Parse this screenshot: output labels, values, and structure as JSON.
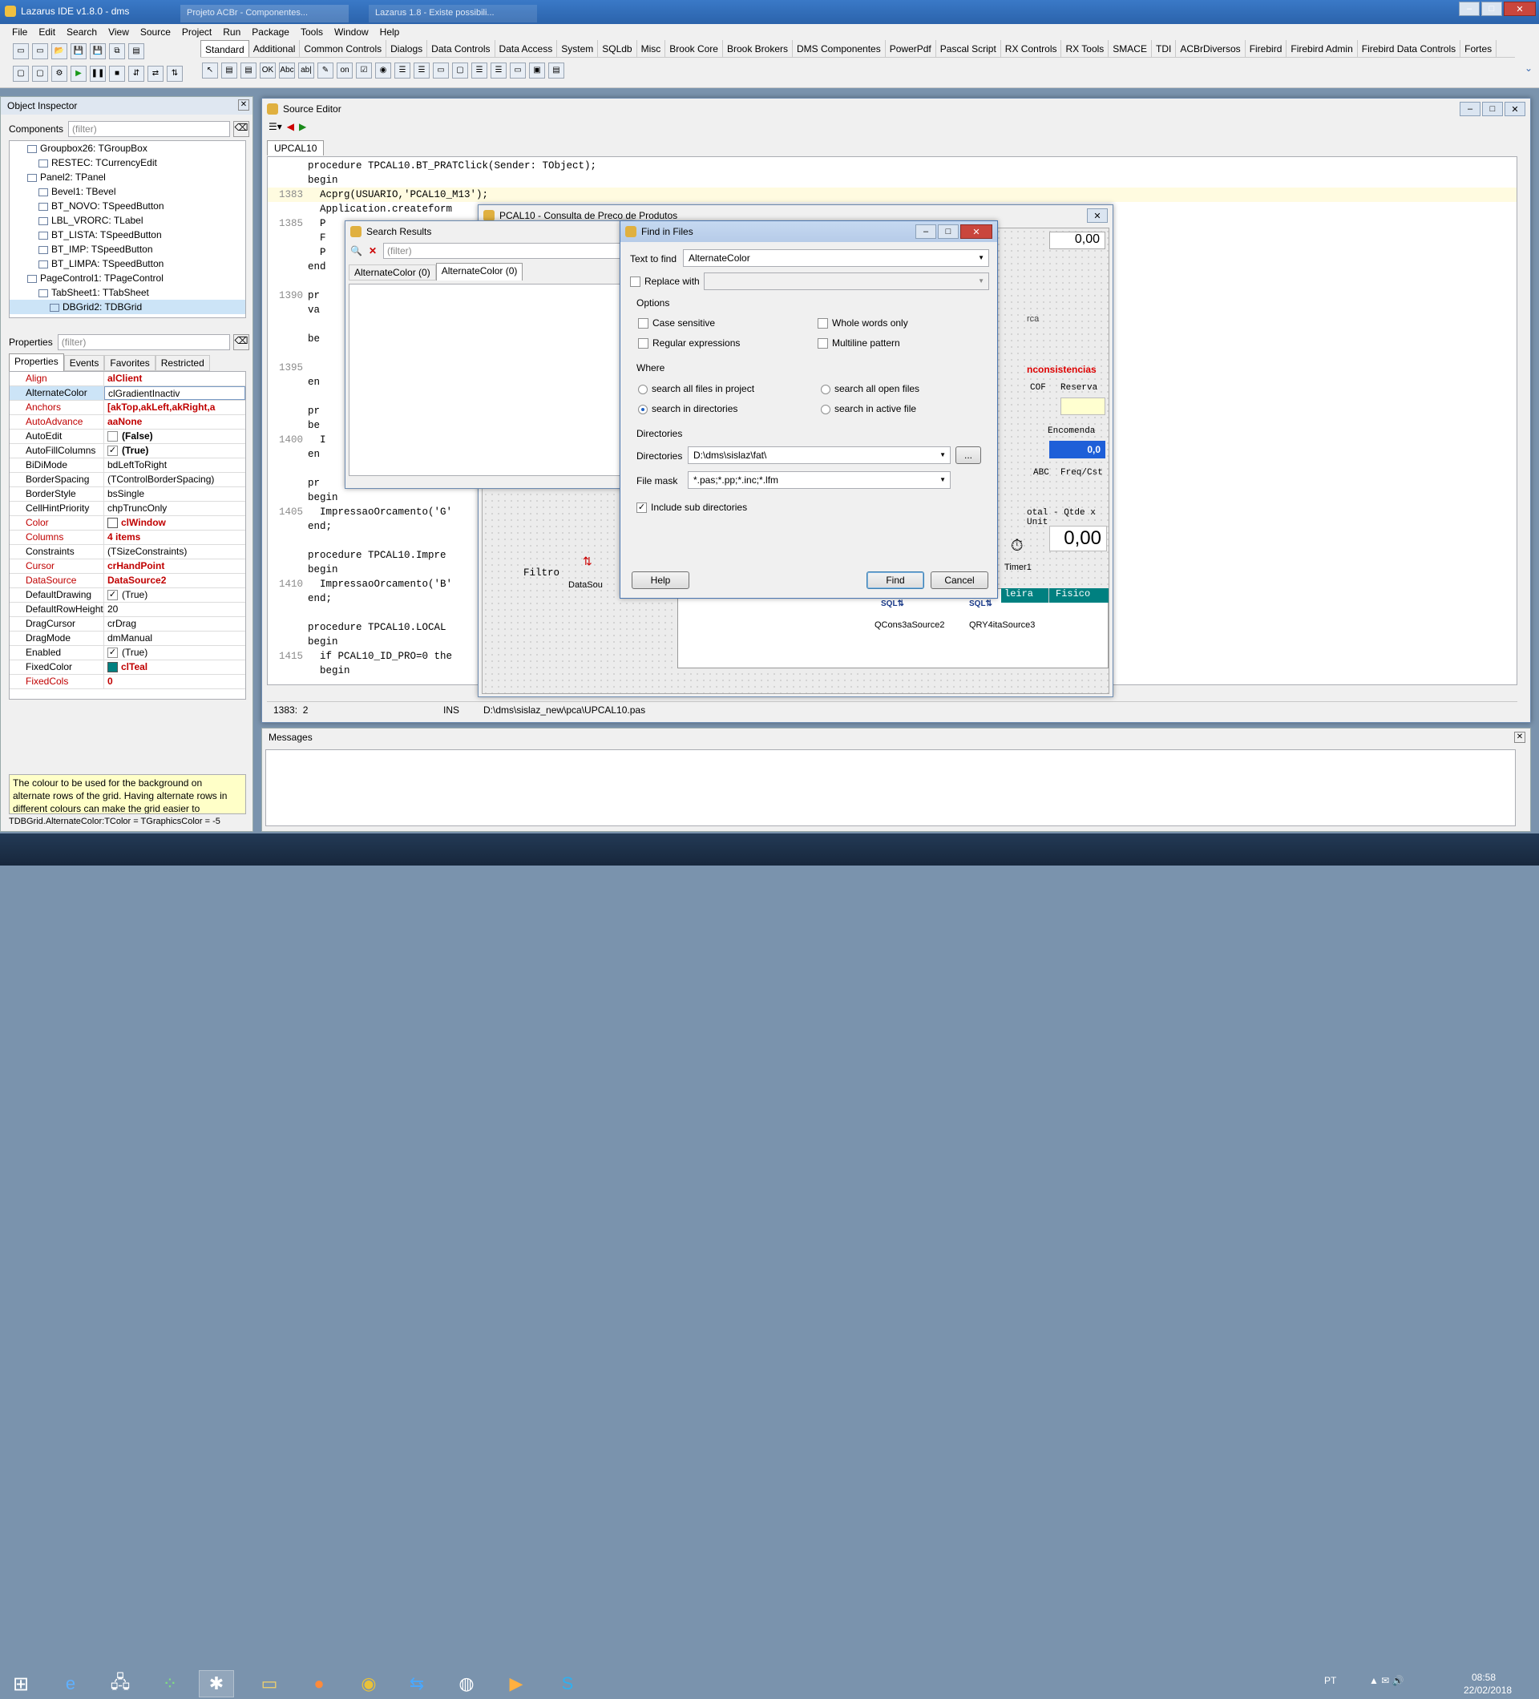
{
  "ide": {
    "title": "Lazarus IDE v1.8.0 - dms",
    "browser_tabs": [
      "Projeto ACBr - Componentes...",
      "Lazarus 1.8 - Existe possibili..."
    ],
    "menu": [
      "File",
      "Edit",
      "Search",
      "View",
      "Source",
      "Project",
      "Run",
      "Package",
      "Tools",
      "Window",
      "Help"
    ],
    "palette_tabs": [
      "Standard",
      "Additional",
      "Common Controls",
      "Dialogs",
      "Data Controls",
      "Data Access",
      "System",
      "SQLdb",
      "Misc",
      "Brook Core",
      "Brook Brokers",
      "DMS Componentes",
      "PowerPdf",
      "Pascal Script",
      "RX Controls",
      "RX Tools",
      "SMACE",
      "TDI",
      "ACBrDiversos",
      "Firebird",
      "Firebird Admin",
      "Firebird Data Controls",
      "Fortes"
    ]
  },
  "object_inspector": {
    "title": "Object Inspector",
    "components_label": "Components",
    "filter_placeholder": "(filter)",
    "tree": [
      {
        "text": "Groupbox26: TGroupBox",
        "indent": 1
      },
      {
        "text": "RESTEC: TCurrencyEdit",
        "indent": 2
      },
      {
        "text": "Panel2: TPanel",
        "indent": 1
      },
      {
        "text": "Bevel1: TBevel",
        "indent": 2
      },
      {
        "text": "BT_NOVO: TSpeedButton",
        "indent": 2
      },
      {
        "text": "LBL_VRORC: TLabel",
        "indent": 2
      },
      {
        "text": "BT_LISTA: TSpeedButton",
        "indent": 2
      },
      {
        "text": "BT_IMP: TSpeedButton",
        "indent": 2
      },
      {
        "text": "BT_LIMPA: TSpeedButton",
        "indent": 2
      },
      {
        "text": "PageControl1: TPageControl",
        "indent": 1
      },
      {
        "text": "TabSheet1: TTabSheet",
        "indent": 2
      },
      {
        "text": "DBGrid2: TDBGrid",
        "indent": 3
      }
    ],
    "properties_label": "Properties",
    "tabs": [
      "Properties",
      "Events",
      "Favorites",
      "Restricted"
    ],
    "props": [
      {
        "name": "Align",
        "value": "alClient",
        "style": "red"
      },
      {
        "name": "AlternateColor",
        "value": "clGradientInactiv",
        "style": "sel"
      },
      {
        "name": "Anchors",
        "value": "[akTop,akLeft,akRight,a",
        "style": "red"
      },
      {
        "name": "AutoAdvance",
        "value": "aaNone",
        "style": "red"
      },
      {
        "name": "AutoEdit",
        "value": "(False)",
        "style": "chk0"
      },
      {
        "name": "AutoFillColumns",
        "value": "(True)",
        "style": "chk1"
      },
      {
        "name": "BiDiMode",
        "value": "bdLeftToRight",
        "style": ""
      },
      {
        "name": "BorderSpacing",
        "value": "(TControlBorderSpacing)",
        "style": ""
      },
      {
        "name": "BorderStyle",
        "value": "bsSingle",
        "style": ""
      },
      {
        "name": "CellHintPriority",
        "value": "chpTruncOnly",
        "style": ""
      },
      {
        "name": "Color",
        "value": "clWindow",
        "style": "color-red"
      },
      {
        "name": "Columns",
        "value": "4 items",
        "style": "red"
      },
      {
        "name": "Constraints",
        "value": "(TSizeConstraints)",
        "style": ""
      },
      {
        "name": "Cursor",
        "value": "crHandPoint",
        "style": "red"
      },
      {
        "name": "DataSource",
        "value": "DataSource2",
        "style": "red"
      },
      {
        "name": "DefaultDrawing",
        "value": "(True)",
        "style": "chk1n"
      },
      {
        "name": "DefaultRowHeight",
        "value": "20",
        "style": ""
      },
      {
        "name": "DragCursor",
        "value": "crDrag",
        "style": ""
      },
      {
        "name": "DragMode",
        "value": "dmManual",
        "style": ""
      },
      {
        "name": "Enabled",
        "value": "(True)",
        "style": "chk1n"
      },
      {
        "name": "FixedColor",
        "value": "clTeal",
        "style": "color-teal"
      },
      {
        "name": "FixedCols",
        "value": "0",
        "style": "red"
      }
    ],
    "hint": "The colour to be used for the background on alternate rows of the grid. Having alternate rows in different colours can make the grid easier to",
    "status": "TDBGrid.AlternateColor:TColor = TGraphicsColor = -5"
  },
  "source_editor": {
    "title": "Source Editor",
    "tab": "UPCAL10",
    "status_pos": "1383:  2",
    "status_mode": "INS",
    "status_file": "D:\\dms\\sislaz_new\\pca\\UPCAL10.pas",
    "lines": [
      {
        "n": "",
        "t": "procedure TPCAL10.BT_PRATClick(Sender: TObject);"
      },
      {
        "n": "",
        "t": "begin"
      },
      {
        "n": "1383",
        "t": "  Acprg(USUARIO,'PCAL10_M13');"
      },
      {
        "n": "",
        "t": "  Application.createform"
      },
      {
        "n": "1385",
        "t": "  P"
      },
      {
        "n": "",
        "t": "  F"
      },
      {
        "n": "",
        "t": "  P"
      },
      {
        "n": "",
        "t": "end"
      },
      {
        "n": "",
        "t": ""
      },
      {
        "n": "1390",
        "t": "pr"
      },
      {
        "n": "",
        "t": "va"
      },
      {
        "n": "",
        "t": ""
      },
      {
        "n": "",
        "t": "be"
      },
      {
        "n": "",
        "t": ""
      },
      {
        "n": "1395",
        "t": ""
      },
      {
        "n": "",
        "t": "en"
      },
      {
        "n": "",
        "t": ""
      },
      {
        "n": "",
        "t": "pr"
      },
      {
        "n": "",
        "t": "be"
      },
      {
        "n": "1400",
        "t": "  I"
      },
      {
        "n": "",
        "t": "en"
      },
      {
        "n": "",
        "t": ""
      },
      {
        "n": "",
        "t": "pr"
      },
      {
        "n": "",
        "t": "begin"
      },
      {
        "n": "1405",
        "t": "  ImpressaoOrcamento('G'"
      },
      {
        "n": "",
        "t": "end;"
      },
      {
        "n": "",
        "t": ""
      },
      {
        "n": "",
        "t": "procedure TPCAL10.Impre"
      },
      {
        "n": "",
        "t": "begin"
      },
      {
        "n": "1410",
        "t": "  ImpressaoOrcamento('B'"
      },
      {
        "n": "",
        "t": "end;"
      },
      {
        "n": "",
        "t": ""
      },
      {
        "n": "",
        "t": "procedure TPCAL10.LOCAL"
      },
      {
        "n": "",
        "t": "begin"
      },
      {
        "n": "1415",
        "t": "  if PCAL10_ID_PRO=0 the"
      },
      {
        "n": "",
        "t": "  begin"
      }
    ]
  },
  "form_designer": {
    "title": "PCAL10 - Consulta de Preco de Produtos",
    "value1": "0,00",
    "label_inconsistencias": "nconsistencias",
    "label_cof": "COF",
    "label_reserva": "Reserva",
    "label_encomenda": "Encomenda",
    "value_encomenda": "0,0",
    "label_abc": "ABC",
    "label_freq": "Freq/Cst",
    "label_total": "otal - Qtde x Unit",
    "value_total": "0,00",
    "label_timer": "Timer1",
    "label_filtro": "Filtro",
    "label_datasource": "DataSou",
    "grid_h1": "leira",
    "grid_h2": "Fisico",
    "comp1": "QCons3aSource2",
    "comp2": "QRY4itaSource3",
    "label_rca": "rca"
  },
  "search_results": {
    "title": "Search Results",
    "filter_placeholder": "(filter)",
    "tabs": [
      "AlternateColor (0)",
      "AlternateColor (0)"
    ]
  },
  "find_dialog": {
    "title": "Find in Files",
    "text_to_find_label": "Text to find",
    "text_to_find_value": "AlternateColor",
    "replace_label": "Replace with",
    "options_label": "Options",
    "case_sensitive": "Case sensitive",
    "whole_words": "Whole words only",
    "regex": "Regular expressions",
    "multiline": "Multiline pattern",
    "where_label": "Where",
    "where_all_project": "search all files in project",
    "where_all_open": "search all open files",
    "where_dirs": "search in directories",
    "where_active": "search in active file",
    "directories_group": "Directories",
    "directories_label": "Directories",
    "directories_value": "D:\\dms\\sislaz\\fat\\",
    "browse_label": "...",
    "filemask_label": "File mask",
    "filemask_value": "*.pas;*.pp;*.inc;*.lfm",
    "include_sub": "Include sub directories",
    "help_btn": "Help",
    "find_btn": "Find",
    "cancel_btn": "Cancel"
  },
  "messages": {
    "title": "Messages"
  },
  "taskbar": {
    "lang": "PT",
    "time": "08:58",
    "date": "22/02/2018"
  }
}
